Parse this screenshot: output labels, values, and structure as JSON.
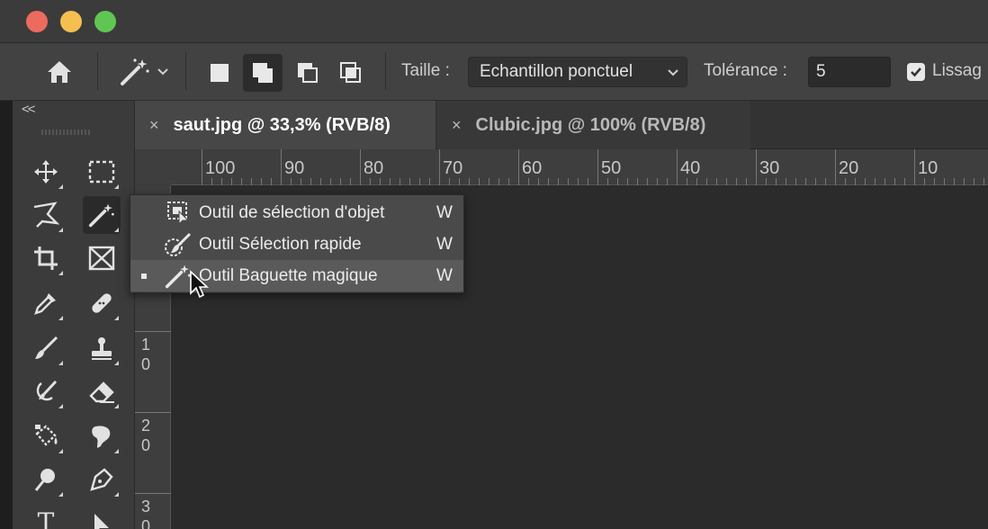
{
  "window": {
    "buttons": [
      "close",
      "minimize",
      "zoom"
    ]
  },
  "options_bar": {
    "home_icon": "home-icon",
    "tool_icon": "magic-wand-icon",
    "size_label": "Taille :",
    "size_value": "Echantillon ponctuel",
    "tolerance_label": "Tolérance :",
    "tolerance_value": "5",
    "antialias_label": "Lissag",
    "antialias_checked": true
  },
  "toolbar": {
    "collapse_label": "<<",
    "tools": [
      {
        "name": "move-tool",
        "icon": "move-icon"
      },
      {
        "name": "marquee-tool",
        "icon": "rect-marquee-icon"
      },
      {
        "name": "lasso-tool",
        "icon": "polygon-lasso-icon"
      },
      {
        "name": "magic-wand-tool",
        "icon": "magic-wand-icon",
        "active": true
      },
      {
        "name": "crop-tool",
        "icon": "crop-icon"
      },
      {
        "name": "frame-tool",
        "icon": "frame-icon"
      },
      {
        "name": "eyedropper-tool",
        "icon": "eyedropper-icon"
      },
      {
        "name": "healing-tool",
        "icon": "bandage-icon"
      },
      {
        "name": "brush-tool",
        "icon": "brush-icon"
      },
      {
        "name": "stamp-tool",
        "icon": "stamp-icon"
      },
      {
        "name": "history-brush-tool",
        "icon": "history-brush-icon"
      },
      {
        "name": "eraser-tool",
        "icon": "eraser-icon"
      },
      {
        "name": "paint-bucket-tool",
        "icon": "paint-bucket-icon"
      },
      {
        "name": "smudge-tool",
        "icon": "smudge-icon"
      },
      {
        "name": "dodge-tool",
        "icon": "dodge-icon"
      },
      {
        "name": "pen-tool",
        "icon": "pen-icon"
      },
      {
        "name": "type-tool",
        "icon": "type-icon",
        "label": "T"
      },
      {
        "name": "path-select-tool",
        "icon": "arrow-icon"
      }
    ]
  },
  "tabs": [
    {
      "label": "saut.jpg @ 33,3% (RVB/8)",
      "active": true
    },
    {
      "label": "Clubic.jpg @ 100% (RVB/8)",
      "active": false
    }
  ],
  "tab_close": "×",
  "ruler": {
    "h_numbers": [
      "100",
      "90",
      "80",
      "70",
      "60",
      "50",
      "40",
      "30",
      "20",
      "10"
    ],
    "v_numbers": [
      [
        "1",
        "0"
      ],
      [
        "2",
        "0"
      ],
      [
        "3",
        "0"
      ]
    ]
  },
  "flyout": {
    "items": [
      {
        "label": "Outil de sélection d'objet",
        "key": "W",
        "icon": "object-selection-icon",
        "selected": false
      },
      {
        "label": "Outil Sélection rapide",
        "key": "W",
        "icon": "quick-selection-icon",
        "selected": false
      },
      {
        "label": "Outil Baguette magique",
        "key": "W",
        "icon": "magic-wand-icon",
        "selected": true
      }
    ]
  },
  "colors": {
    "panel": "#3b3b3b",
    "optbar": "#424242",
    "canvas": "#2b2b2b",
    "tab_active": "#474747",
    "menu": "#4a4a4a",
    "menu_selected": "#5a5a5a"
  }
}
